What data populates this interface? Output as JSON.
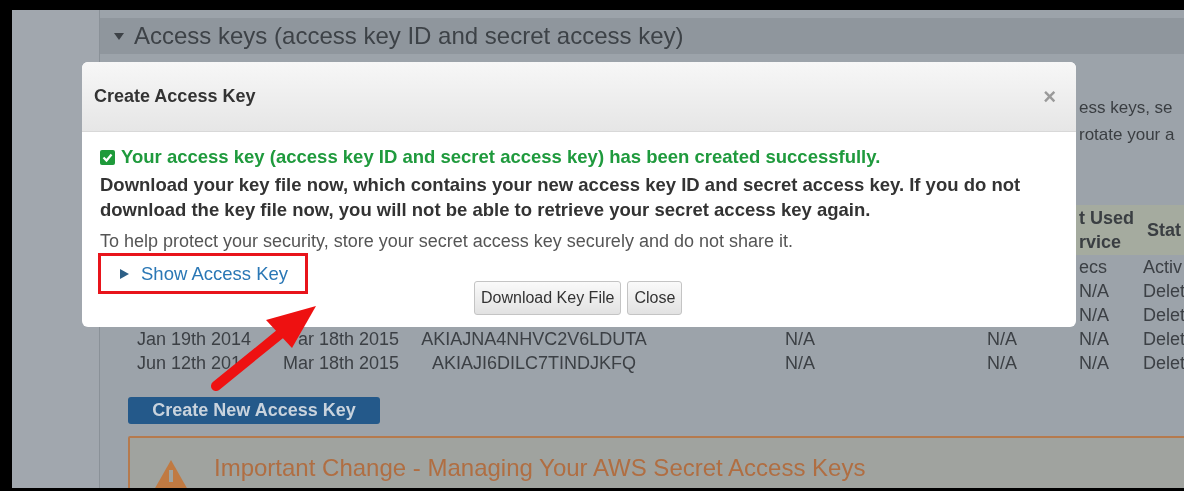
{
  "page": {
    "section_title": "Access keys (access key ID and secret access key)",
    "description_lines": [
      "ess keys, se",
      "rotate your a"
    ],
    "table": {
      "headers": [
        "t Used rvice",
        "Stat"
      ],
      "rows": [
        {
          "service": "ecs",
          "status": "Activ"
        },
        {
          "service": "N/A",
          "status": "Delet"
        },
        {
          "service": "N/A",
          "status": "Delet"
        },
        {
          "created": "Jan 19th 2014",
          "last_used": "ar 18th 2015",
          "key_id": "AKIAJNA4NHVC2V6LDUTA",
          "column_4": "N/A",
          "column_5": "N/A",
          "service": "N/A",
          "status": "Delet"
        },
        {
          "created": "Jun 12th 201",
          "last_used": "Mar 18th 2015",
          "key_id": "AKIAJI6DILC7TINDJKFQ",
          "column_4": "N/A",
          "column_5": "N/A",
          "service": "N/A",
          "status": "Delet"
        }
      ]
    },
    "create_button": "Create New Access Key",
    "notice": {
      "title": "Important Change - Managing Your AWS Secret Access Keys"
    }
  },
  "dialog": {
    "title": "Create Access Key",
    "close": "×",
    "success": "Your access key (access key ID and secret access key) has been created successfully.",
    "warning": "Download your key file now, which contains your new access key ID and secret access key. If you do not download the key file now, you will not be able to retrieve your secret access key again.",
    "note": "To help protect your security, store your secret access key securely and do not share it.",
    "show_key": {
      "label": "Show Access Key",
      "expanded": false,
      "highlighted": true
    },
    "buttons": [
      "Download Key File",
      "Close"
    ]
  }
}
